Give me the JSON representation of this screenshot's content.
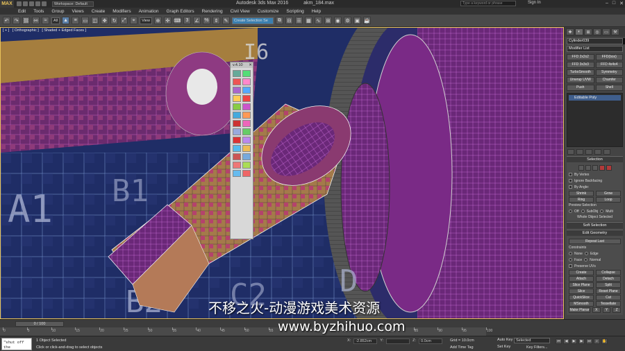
{
  "titlebar": {
    "workspace": "Workspace: Default",
    "app_title": "Autodesk 3ds Max 2016",
    "file_name": "akm_184.max",
    "search_placeholder": "Type a keyword or phrase",
    "signin": "Sign In"
  },
  "menubar": [
    "Edit",
    "Tools",
    "Group",
    "Views",
    "Create",
    "Modifiers",
    "Animation",
    "Graph Editors",
    "Rendering",
    "Civil View",
    "Customize",
    "Scripting",
    "Help"
  ],
  "toolbar": {
    "selection_filter": "All",
    "ref_coord": "View",
    "named_selection": "Create Selection Se"
  },
  "viewport": {
    "label_plus": "[ + ]",
    "label_view": "[ Orthographic ]",
    "label_shading": "[ Shaded + Edged Faces ]"
  },
  "float_toolbar": {
    "version": "v.4.10",
    "icon_colors": [
      "#6a9",
      "#5d7",
      "#e55",
      "#f8c",
      "#a6c",
      "#5af",
      "#fc5",
      "#e44",
      "#8c4",
      "#c5c",
      "#4ad",
      "#f95",
      "#c33",
      "#e6b",
      "#9ad",
      "#6c6",
      "#d33",
      "#b8e",
      "#5be",
      "#eb5",
      "#c55",
      "#7ad",
      "#e77",
      "#ad5",
      "#6be",
      "#e66"
    ]
  },
  "cmdpanel": {
    "object_name": "Cylinder039",
    "modifier_list": "Modifier List",
    "modifiers": [
      "FFD 2x2x2",
      "FFD(box)",
      "FFD 3x3x3",
      "FFD 4x4x4",
      "TurboSmooth",
      "Symmetry",
      "Unwrap UVW",
      "Chamfer",
      "Push",
      "Shell"
    ],
    "stack_item": "Editable Poly",
    "selection_head": "Selection",
    "by_vertex": "By Vertex",
    "ignore_backfacing": "Ignore Backfacing",
    "by_angle": "By Angle:",
    "shrink": "Shrink",
    "grow": "Grow",
    "ring": "Ring",
    "loop": "Loop",
    "preview_selection": "Preview Selection",
    "off": "Off",
    "subobj": "SubObj",
    "multi": "Multi",
    "whole_object": "Whole Object Selected",
    "soft_selection": "Soft Selection",
    "edit_geometry": "Edit Geometry",
    "repeat_last": "Repeat Last",
    "constraints": "Constraints",
    "none": "None",
    "edge": "Edge",
    "face": "Face",
    "normal": "Normal",
    "preserve_uvs": "Preserve UVs",
    "create": "Create",
    "collapse": "Collapse",
    "attach": "Attach",
    "detach": "Detach",
    "slice_plane": "Slice Plane",
    "split": "Split",
    "slice": "Slice",
    "reset_plane": "Reset Plane",
    "quickslice": "QuickSlice",
    "cut": "Cut",
    "msmooth": "MSmooth",
    "tessellate": "Tessellate",
    "make_planar": "Make Planar",
    "x": "X",
    "y": "Y",
    "z": "Z"
  },
  "timeline": {
    "slider": "0 / 100",
    "ticks": [
      "0",
      "5",
      "10",
      "15",
      "20",
      "25",
      "30",
      "35",
      "40",
      "45",
      "50",
      "55",
      "60",
      "65",
      "70",
      "75",
      "80",
      "85",
      "90",
      "95",
      "100"
    ]
  },
  "statusbar": {
    "maxscript": "\"shut off the",
    "status": "1 Object Selected",
    "prompt": "Click or click-and-drag to select objects",
    "x_val": "-2.852cm",
    "y_val": "",
    "z_val": "0.0cm",
    "grid": "Grid = 10.0cm",
    "add_time_tag": "Add Time Tag",
    "auto_key": "Auto Key",
    "selected": "Selected",
    "set_key": "Set Key",
    "key_filters": "Key Filters..."
  },
  "watermark": {
    "line1": "不移之火-动漫游戏美术资源",
    "line2": "www.byzhihuo.com"
  }
}
